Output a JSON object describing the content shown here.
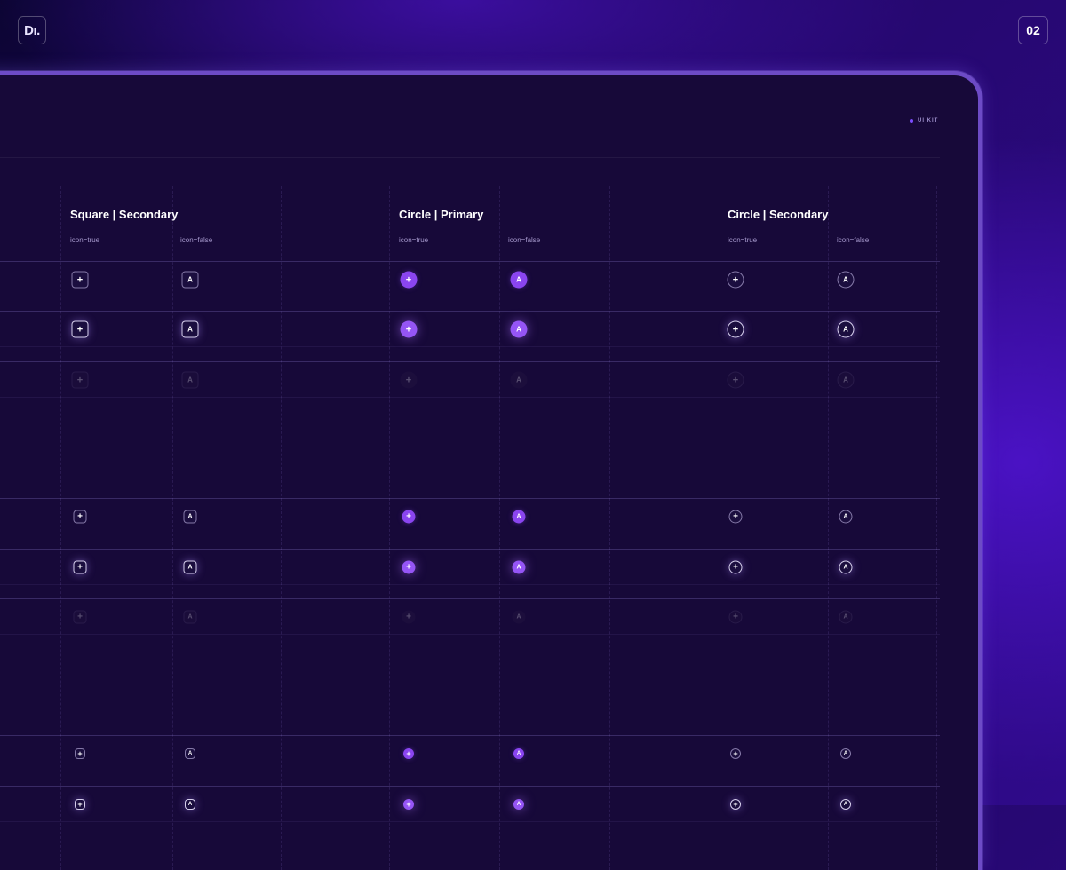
{
  "header": {
    "logo_text": "Dı.",
    "page_number": "02"
  },
  "frame": {
    "tag": "UI KIT"
  },
  "sections": [
    {
      "title": "Square | Secondary",
      "labels": [
        "icon=true",
        "icon=false"
      ]
    },
    {
      "title": "Circle | Primary",
      "labels": [
        "icon=true",
        "icon=false"
      ]
    },
    {
      "title": "Circle | Secondary",
      "labels": [
        "icon=true",
        "icon=false"
      ]
    }
  ],
  "glyphs": {
    "icon": "+",
    "letter": "A"
  },
  "colors": {
    "background": "#2a0a8a",
    "frame": "#170939",
    "frame_border": "#6d4bc6",
    "primary_accent": "#8a45f0",
    "text": "#ffffff",
    "muted_text": "#a598cc"
  }
}
